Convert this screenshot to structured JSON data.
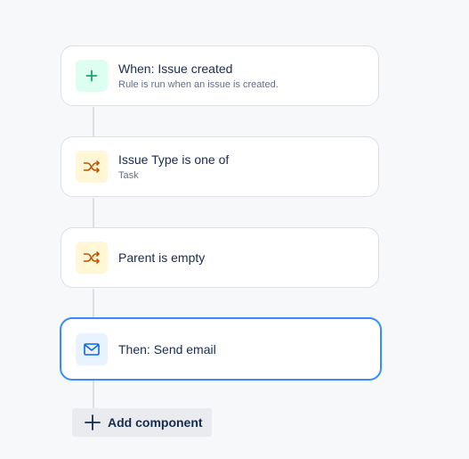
{
  "rule": {
    "components": [
      {
        "kind": "trigger",
        "icon": "plus-icon",
        "icon_color": "#22a06b",
        "title": "When: Issue created",
        "subtitle": "Rule is run when an issue is created."
      },
      {
        "kind": "condition",
        "icon": "shuffle-icon",
        "icon_color": "#c25100",
        "title": "Issue Type is one of",
        "subtitle": "Task"
      },
      {
        "kind": "condition",
        "icon": "shuffle-icon",
        "icon_color": "#c25100",
        "title": "Parent is empty"
      },
      {
        "kind": "action",
        "icon": "mail-icon",
        "icon_color": "#0c66e4",
        "title": "Then: Send email",
        "selected": true
      }
    ]
  },
  "add_component": {
    "icon": "plus-icon",
    "label": "Add component"
  },
  "colors": {
    "background": "#f7f8f9",
    "card_border": "#dcdfe4",
    "selected_border": "#388bff",
    "connector": "#dcdfe4"
  }
}
